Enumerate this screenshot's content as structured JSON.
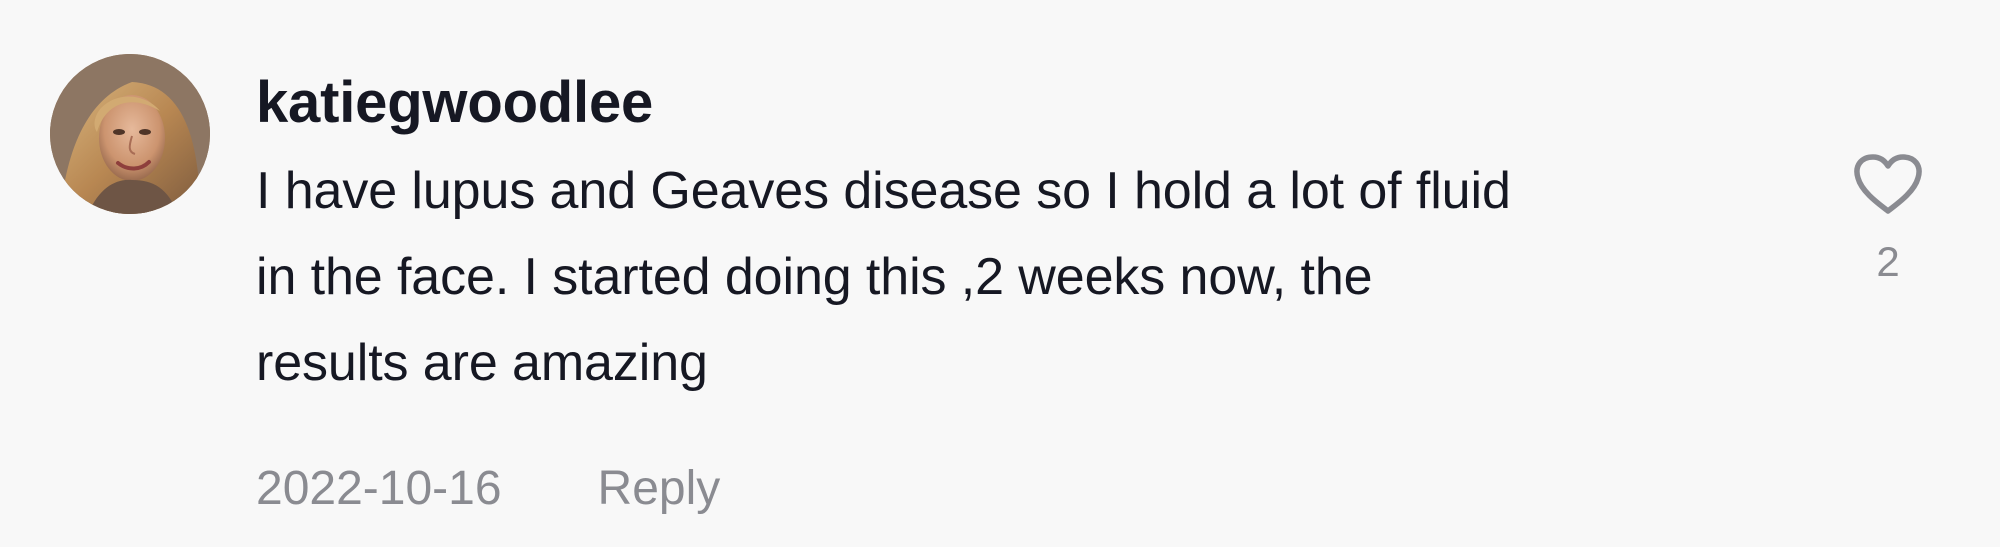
{
  "comment": {
    "username": "katiegwoodlee",
    "body_lines": [
      "I have lupus and Geaves disease so I hold a lot of fluid",
      "in the face. I started doing this ,2 weeks now, the",
      "results are amazing"
    ],
    "date": "2022-10-16",
    "reply_label": "Reply",
    "like_count": "2",
    "icons": {
      "avatar": "user-avatar",
      "like": "heart-outline-icon"
    },
    "colors": {
      "text": "#161823",
      "secondary_text": "#8a8b91",
      "background": "#f8f8f8"
    }
  }
}
